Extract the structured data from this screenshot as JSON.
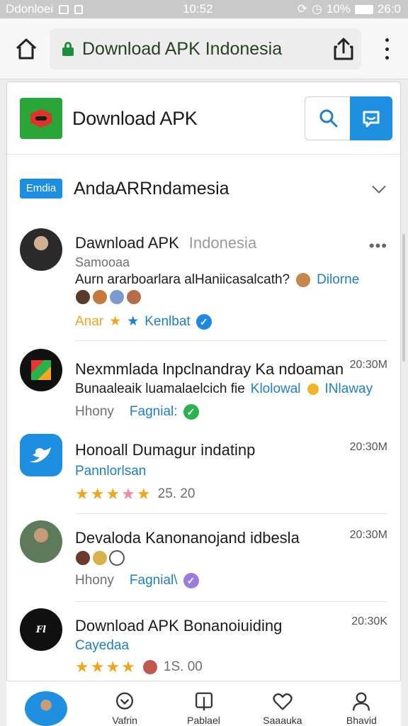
{
  "status_bar": {
    "carrier": "Ddonloei",
    "time": "10:52",
    "battery_pct": "10%",
    "right_time": "26:0"
  },
  "browser": {
    "url_text": "Download APK Indonesia"
  },
  "site": {
    "title": "Download APK"
  },
  "section": {
    "badge": "Emdia",
    "title": "AndaARRndamesia"
  },
  "items": [
    {
      "title": "Dawnload APK",
      "title_muted": "Indonesia",
      "sub": "Samooaa",
      "line1_text": "Aurn ararboarlara alHaniicasalcath?",
      "line1_link": "Dilorne",
      "tag_a": "Anar",
      "tag_b": "Kenlbat"
    },
    {
      "title": "Nexmmlada lnpclnandray Ka ndoaman",
      "time": "20:30M",
      "line1_text": "Bunaaleaik luamalaelcich fie",
      "line1_link": "Klolowal",
      "line1_link2": "INlaway",
      "meta_a": "Hhony",
      "meta_b": "Fagnial:"
    },
    {
      "title": "Honoall Dumagur indatinp",
      "time": "20:30M",
      "sub": "Pannlorlsan",
      "rating_text": "25. 20",
      "stars": 4
    },
    {
      "title": "Devaloda Kanonanojand idbesla",
      "time": "20:30M",
      "meta_a": "Hhony",
      "meta_b": "Fagnial\\"
    },
    {
      "title": "Download APK",
      "title_rest": "Bonanoiuiding",
      "time": "20:30K",
      "sub": "Cayedaa",
      "rating_text": "1S. 00",
      "stars": 4
    }
  ],
  "bottom_nav": [
    {
      "label": "",
      "icon": "profile-avatar"
    },
    {
      "label": "Vafrin",
      "icon": "heart-clock-icon"
    },
    {
      "label": "Pablael",
      "icon": "download-box-icon"
    },
    {
      "label": "Saaauka",
      "icon": "heart-icon"
    },
    {
      "label": "Bhavid",
      "icon": "user-icon"
    }
  ],
  "colors": {
    "accent": "#1f8fe0",
    "brand_green": "#2aa53a",
    "check_blue": "#1e88e5",
    "check_green": "#2bb24c",
    "check_purple": "#9b7be0",
    "star": "#f0a51d"
  }
}
